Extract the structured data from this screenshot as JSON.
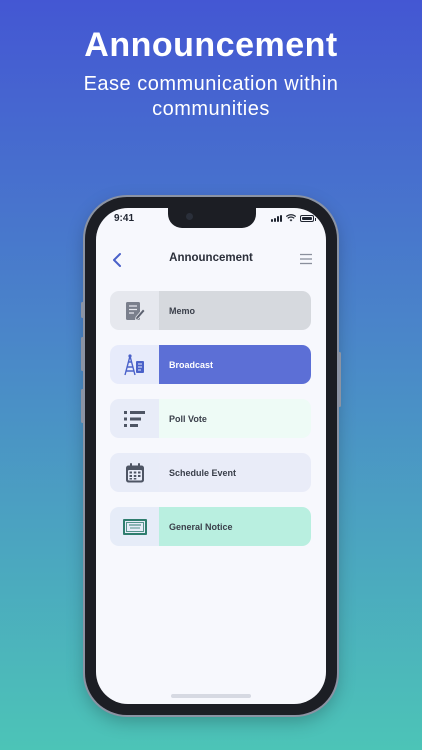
{
  "hero": {
    "title": "Announcement",
    "subtitle": "Ease communication within communities"
  },
  "status_bar": {
    "time": "9:41"
  },
  "nav": {
    "title": "Announcement",
    "back_icon": "chevron-left-icon",
    "menu_icon": "hamburger-menu-icon"
  },
  "colors": {
    "background_top": "#4457d3",
    "background_bottom": "#4cc4b7",
    "accent": "#4a61c9"
  },
  "items": [
    {
      "label": "Memo",
      "icon": "memo-icon",
      "label_bg": "#d6d9de",
      "label_color": "#3a3f4a",
      "icon_bg": "#e6e8ee"
    },
    {
      "label": "Broadcast",
      "icon": "broadcast-icon",
      "label_bg": "#5c6fd6",
      "label_color": "#ffffff",
      "icon_bg": "#e7ebfb"
    },
    {
      "label": "Poll Vote",
      "icon": "poll-list-icon",
      "label_bg": "#eefbf6",
      "label_color": "#3a3f4a",
      "icon_bg": "#e8ecf8"
    },
    {
      "label": "Schedule Event",
      "icon": "calendar-icon",
      "label_bg": "#e9ecf8",
      "label_color": "#3a3f4a",
      "icon_bg": "#e8ecf8"
    },
    {
      "label": "General Notice",
      "icon": "certificate-icon",
      "label_bg": "#b9efe0",
      "label_color": "#3a3f4a",
      "icon_bg": "#e6ecf8"
    }
  ]
}
